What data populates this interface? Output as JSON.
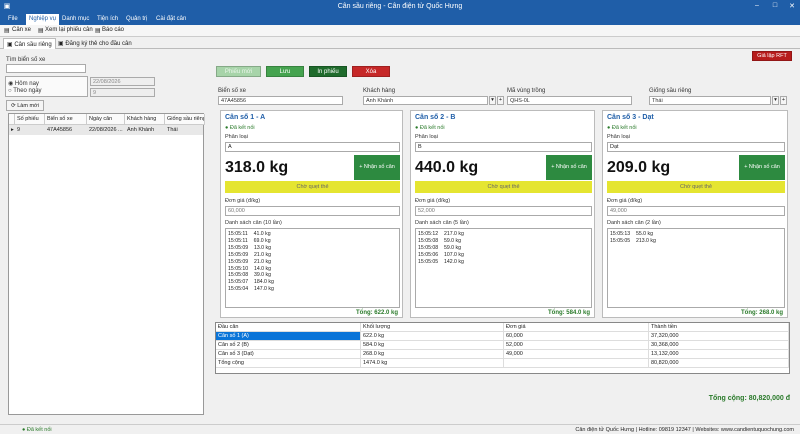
{
  "window": {
    "title": "Cân sầu riêng - Cân điện tử Quốc Hưng"
  },
  "menu": [
    "File",
    "Nghiệp vụ",
    "Danh mục",
    "Tiện ích",
    "Quản trị",
    "Cài đặt cân"
  ],
  "toolbar": [
    "Cân xe",
    "Xem lại phiếu cân",
    "Báo cáo"
  ],
  "tabs": [
    "Cân sầu riêng",
    "Đăng ký thẻ cho đầu cân"
  ],
  "search": {
    "label": "Tìm biển số xe",
    "value": ""
  },
  "filter": {
    "today": "Hôm nay",
    "by_day": "Theo ngày",
    "date": "22/08/2026",
    "count": "9"
  },
  "refresh_label": "Làm mới",
  "grid": {
    "headers": [
      "Số phiếu",
      "Biển số xe",
      "Ngày cân",
      "Khách hàng",
      "Giống sầu riêng"
    ],
    "rows": [
      [
        "9",
        "47A45856",
        "22/08/2026 ...",
        "Anh Khánh",
        "Thái"
      ]
    ]
  },
  "actions": {
    "phieu_moi": "Phiếu mới",
    "luu": "Lưu",
    "in_phieu": "In phiếu",
    "xoa": "Xóa",
    "gia_lap": "Giả lập RFT"
  },
  "fields": {
    "bien_so_label": "Biển số xe",
    "bien_so": "47A45856",
    "khach_hang_label": "Khách hàng",
    "khach_hang": "Anh Khánh",
    "ma_vung_label": "Mã vùng trồng",
    "ma_vung": "QHS-0L",
    "giong_label": "Giống sầu riêng",
    "giong": "Thái"
  },
  "scale_labels": {
    "status": "● Đã kết nối",
    "phan_loai": "Phân loại",
    "nhan": "+ Nhận số cân",
    "wait": "Chờ quẹt thẻ",
    "don_gia": "Đơn giá (đ/kg)"
  },
  "scales": [
    {
      "name": "Cân số 1 - A",
      "phan_loai": "A",
      "weight": "318.0 kg",
      "price": "60,000",
      "list_title": "Danh sách cân (10 lần)",
      "total": "Tổng: 622.0 kg",
      "entries": [
        "15:05:11    41.0 kg",
        "15:05:11    69.0 kg",
        "15:05:09    13.0 kg",
        "15:05:09    21.0 kg",
        "15:05:09    21.0 kg",
        "15:05:10    14.0 kg",
        "15:05:08    39.0 kg",
        "15:05:07    184.0 kg",
        "15:05:04    147.0 kg"
      ]
    },
    {
      "name": "Cân số 2 - B",
      "phan_loai": "B",
      "weight": "440.0 kg",
      "price": "52,000",
      "list_title": "Danh sách cân (5 lần)",
      "total": "Tổng: 584.0 kg",
      "entries": [
        "15:05:12    217.0 kg",
        "15:05:08    59.0 kg",
        "15:05:08    59.0 kg",
        "15:05:06    107.0 kg",
        "15:05:05    142.0 kg"
      ]
    },
    {
      "name": "Cân số 3 - Dạt",
      "phan_loai": "Dạt",
      "weight": "209.0 kg",
      "price": "49,000",
      "list_title": "Danh sách cân (2 lần)",
      "total": "Tổng: 268.0 kg",
      "entries": [
        "15:05:13    55.0 kg",
        "15:05:05    213.0 kg"
      ]
    }
  ],
  "summary": {
    "headers": [
      "Đầu cân",
      "Khối lượng",
      "Đơn giá",
      "Thành tiền"
    ],
    "rows": [
      [
        "Cân số 1 (A)",
        "622.0 kg",
        "60,000",
        "37,320,000"
      ],
      [
        "Cân số 2 (B)",
        "584.0 kg",
        "52,000",
        "30,368,000"
      ],
      [
        "Cân số 3 (Dạt)",
        "268.0 kg",
        "49,000",
        "13,132,000"
      ],
      [
        "Tổng cộng",
        "1474.0 kg",
        "",
        "80,820,000"
      ]
    ]
  },
  "grand_total": "Tổng cộng: 80,820,000 đ",
  "status": {
    "left": "● Đã kết nối",
    "right": "Cân điện tử Quốc Hưng | Hotline: 09819 12347 | Websites: www.candientuquochung.com"
  },
  "colors": {
    "accent": "#1f5ea8",
    "green": "#2d8a40",
    "red": "#c62828",
    "yellow": "#e5e531"
  }
}
